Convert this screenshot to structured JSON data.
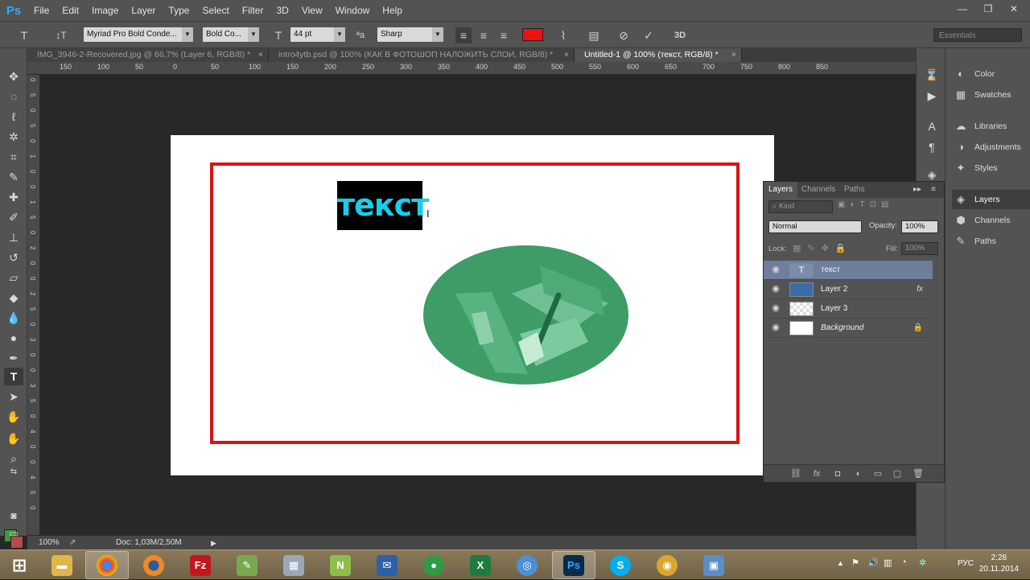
{
  "app": {
    "logo": "Ps",
    "menu": [
      "File",
      "Edit",
      "Image",
      "Layer",
      "Type",
      "Select",
      "Filter",
      "3D",
      "View",
      "Window",
      "Help"
    ],
    "window_controls": {
      "minimize": "—",
      "restore": "❐",
      "close": "✕"
    }
  },
  "options_bar": {
    "tool_icon": "T",
    "orient_icon": "↕T",
    "font_family": "Myriad Pro Bold Conde...",
    "font_style": "Bold Co...",
    "size_icon": "T",
    "font_size": "44 pt",
    "aa_icon": "ªa",
    "antialias": "Sharp",
    "text_color": "#ee1111",
    "workspace": "Essentials",
    "commit_icon": "✓",
    "cancel_icon": "⊘",
    "three_d": "3D"
  },
  "tabs": [
    {
      "label": "IMG_3946-2-Recovered.jpg @ 66,7% (Layer 6, RGB/8) *",
      "active": false
    },
    {
      "label": "intro4ytb.psd @ 100% (КАК В ФОТОШОП НАЛОЖИТЬ СЛОИ, RGB/8) *",
      "active": false
    },
    {
      "label": "Untitled-1 @ 100% (текст, RGB/8) *",
      "active": true
    }
  ],
  "tab_close": "×",
  "ruler": {
    "top_labels": [
      "150",
      "100",
      "50",
      "0",
      "50",
      "100",
      "150",
      "200",
      "250",
      "300",
      "350",
      "400",
      "450",
      "500",
      "550",
      "600",
      "650",
      "700",
      "750",
      "800",
      "850"
    ],
    "left_labels": [
      "0",
      "5",
      "0",
      "5",
      "0",
      "1",
      "0",
      "0",
      "1",
      "5",
      "0",
      "2",
      "0",
      "0",
      "2",
      "5",
      "0",
      "3",
      "0",
      "0",
      "3",
      "5",
      "0",
      "4",
      "0",
      "0",
      "4",
      "5",
      "0"
    ]
  },
  "canvas": {
    "text": "текст",
    "ibeam": "I"
  },
  "status": {
    "zoom": "100%",
    "doc": "Doc: 1,03M/2,50M"
  },
  "right_panels": [
    {
      "name": "Color",
      "icon": "◐"
    },
    {
      "name": "Swatches",
      "icon": "▦"
    },
    {
      "name": "Libraries",
      "icon": "☁"
    },
    {
      "name": "Adjustments",
      "icon": "◑"
    },
    {
      "name": "Styles",
      "icon": "✦"
    },
    {
      "name": "Layers",
      "icon": "◈"
    },
    {
      "name": "Channels",
      "icon": "⬢"
    },
    {
      "name": "Paths",
      "icon": "✎"
    }
  ],
  "layers_panel": {
    "tabs": [
      "Layers",
      "Channels",
      "Paths"
    ],
    "kind": "Kind",
    "blend_mode": "Normal",
    "opacity_label": "Opacity:",
    "opacity": "100%",
    "lock_label": "Lock:",
    "fill_label": "Fill:",
    "fill": "100%",
    "layers": [
      {
        "name": "текст",
        "type": "text",
        "selected": true,
        "extra": ""
      },
      {
        "name": "Layer 2",
        "type": "fill",
        "selected": false,
        "extra": "fx"
      },
      {
        "name": "Layer 3",
        "type": "image",
        "selected": false,
        "extra": ""
      },
      {
        "name": "Background",
        "type": "background",
        "selected": false,
        "extra": "🔒"
      }
    ]
  },
  "taskbar": {
    "apps": [
      "windows-explorer",
      "chrome",
      "firefox",
      "filezilla",
      "editor",
      "calculator",
      "notepadpp",
      "outlook",
      "app-green",
      "excel",
      "network",
      "photoshop",
      "skype",
      "webcam",
      "photos"
    ],
    "lang": "РУС",
    "time": "2:28",
    "date": "20.11.2014"
  }
}
